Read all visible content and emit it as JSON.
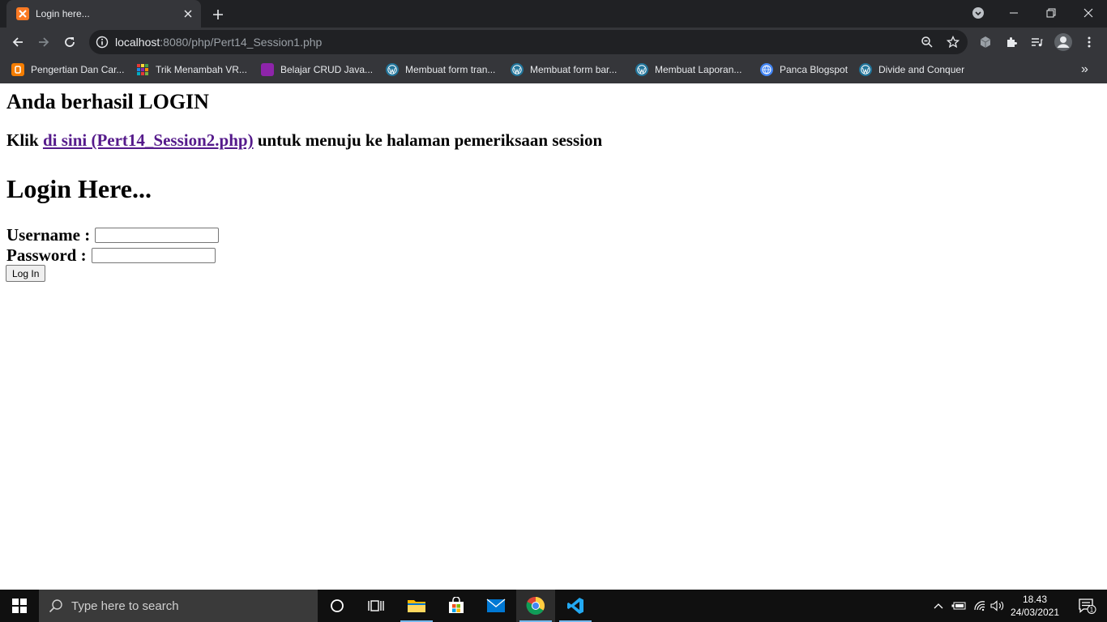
{
  "browser": {
    "tab": {
      "title": "Login here...",
      "favicon": "xampp-icon"
    },
    "url": {
      "host": "localhost",
      "rest": ":8080/php/Pert14_Session1.php"
    },
    "bookmarks": [
      {
        "label": "Pengertian Dan Car...",
        "icon": "blogger-icon",
        "color": "#f57d00"
      },
      {
        "label": "Trik Menambah VR...",
        "icon": "grid-icon",
        "color": "#e53935"
      },
      {
        "label": "Belajar CRUD Java...",
        "icon": "site-icon",
        "color": "#8e24aa"
      },
      {
        "label": "Membuat form tran...",
        "icon": "wordpress-icon",
        "color": "#21759b"
      },
      {
        "label": "Membuat form bar...",
        "icon": "wordpress-icon",
        "color": "#21759b"
      },
      {
        "label": "Membuat Laporan...",
        "icon": "wordpress-icon",
        "color": "#21759b"
      },
      {
        "label": "Panca Blogspot",
        "icon": "globe-icon",
        "color": "#4285f4"
      },
      {
        "label": "Divide and Conquer",
        "icon": "wordpress-icon",
        "color": "#21759b"
      }
    ],
    "bookmarks_more": "»"
  },
  "page": {
    "success_heading": "Anda berhasil LOGIN",
    "link_prefix": "Klik",
    "link_text": "di sini (Pert14_Session2.php)",
    "link_suffix": "untuk menuju ke halaman pemeriksaan session",
    "login_heading": "Login Here...",
    "username_label": "Username :",
    "username_value": "",
    "password_label": "Password :",
    "password_value": "",
    "login_button": "Log In"
  },
  "taskbar": {
    "search_placeholder": "Type here to search",
    "time": "18.43",
    "date": "24/03/2021",
    "notification_count": "1"
  },
  "colors": {
    "link_visited": "#551a8b",
    "chrome_dark": "#202124",
    "chrome_toolbar": "#35363a",
    "taskbar_accent": "#76b9ed"
  }
}
